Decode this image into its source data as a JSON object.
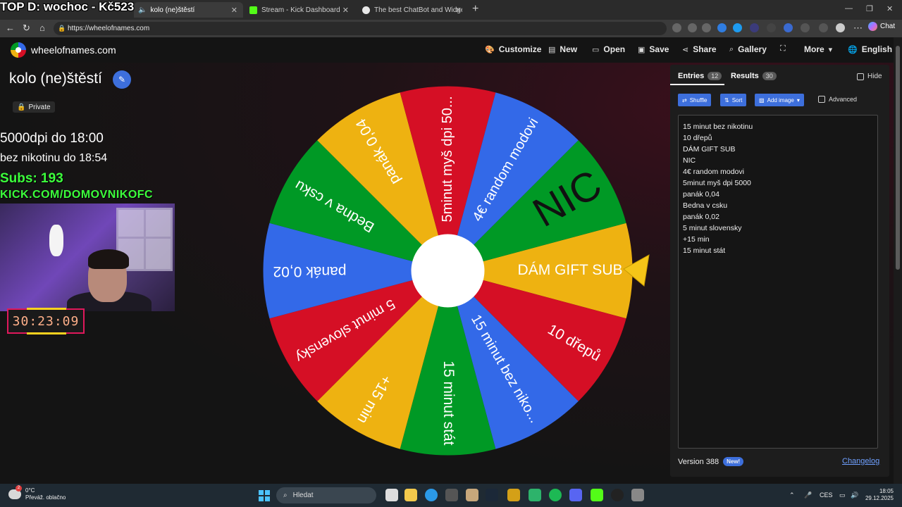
{
  "browser": {
    "tabs": [
      {
        "label": "kolo (ne)štěstí",
        "active": true
      },
      {
        "label": "Stream - Kick Dashboard",
        "active": false
      },
      {
        "label": "The best ChatBot and Widgets for",
        "active": false
      }
    ],
    "url": "https://wheelofnames.com",
    "chat_label": "Chat"
  },
  "stream_overlay": {
    "top_text": "TOP D: wochoc - Kč523",
    "line1": "5000dpi do 18:00",
    "line2": "bez nikotinu do 18:54",
    "subs": "Subs: 193",
    "kick": "KICK.COM/DOMOVNIKOFC",
    "timer": "30:23:09"
  },
  "site": {
    "name": "wheelofnames.com",
    "menu": [
      "Customize",
      "New",
      "Open",
      "Save",
      "Share",
      "Gallery",
      "More",
      "English"
    ]
  },
  "wheel": {
    "title": "kolo (ne)štěstí",
    "visibility": "Private",
    "segments": [
      {
        "label": "DÁM GIFT SUB",
        "color": "#eeb211"
      },
      {
        "label": "10 dřepů",
        "color": "#d50f25"
      },
      {
        "label": "15 minut bez niko...",
        "color": "#3369e8"
      },
      {
        "label": "15 minut stát",
        "color": "#009925"
      },
      {
        "label": "+15 min",
        "color": "#eeb211"
      },
      {
        "label": "5 minut slovensky",
        "color": "#d50f25"
      },
      {
        "label": "panák 0,02",
        "color": "#3369e8"
      },
      {
        "label": "Bedna v csku",
        "color": "#009925"
      },
      {
        "label": "panák 0,04",
        "color": "#eeb211"
      },
      {
        "label": "5minut myš dpi 50...",
        "color": "#d50f25"
      },
      {
        "label": "4€ random modovi",
        "color": "#3369e8"
      },
      {
        "label": "NIC",
        "color": "#009925"
      }
    ]
  },
  "panel": {
    "tab_entries": "Entries",
    "entries_count": "12",
    "tab_results": "Results",
    "results_count": "30",
    "hide_label": "Hide",
    "shuffle_label": "Shuffle",
    "sort_label": "Sort",
    "add_image_label": "Add image",
    "advanced_label": "Advanced",
    "entries": [
      "15 minut bez nikotinu",
      "10 dřepů",
      "DÁM GIFT SUB",
      "NIC",
      "4€ random modovi",
      "5minut myš dpi 5000",
      "panák 0,04",
      "Bedna v csku",
      "panák 0,02",
      "5 minut slovensky",
      "+15 min",
      "15 minut stát"
    ],
    "version": "Version 388",
    "new_badge": "New!",
    "changelog": "Changelog"
  },
  "taskbar": {
    "temperature": "0°C",
    "weather": "Převáž. oblačno",
    "search": "Hledat",
    "language": "CES",
    "time": "18:05",
    "date": "29.12.2025"
  },
  "colors": {
    "accent": "#3d6fdc",
    "wheel_green": "#009925",
    "wheel_red": "#d50f25",
    "wheel_blue": "#3369e8",
    "wheel_yellow": "#eeb211",
    "overlay_green": "#3cff3c"
  }
}
